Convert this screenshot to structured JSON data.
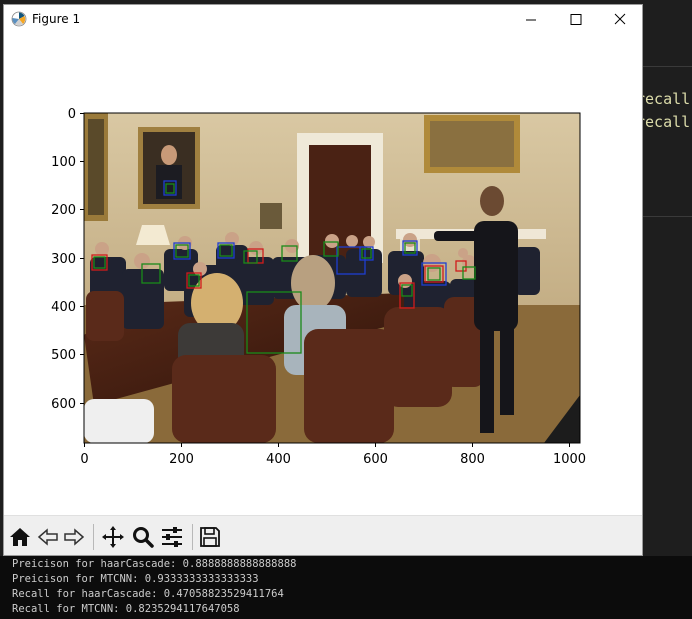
{
  "window": {
    "title": "Figure 1",
    "icons": [
      "matplotlib-logo-icon",
      "minimize-icon",
      "maximize-icon",
      "close-icon"
    ]
  },
  "editor": {
    "code_lines": [
      "recall",
      "recall"
    ],
    "text_color": "#dcdcaa"
  },
  "figure": {
    "x_ticks": [
      "0",
      "200",
      "400",
      "600",
      "800",
      "1000"
    ],
    "y_ticks": [
      "0",
      "100",
      "200",
      "300",
      "400",
      "500",
      "600"
    ],
    "image_width": 1024,
    "image_height": 683,
    "box_colors": {
      "blue": "#1f3fd0",
      "green": "#1a8a1a",
      "red": "#d01c1c"
    }
  },
  "toolbar": {
    "buttons": [
      "home-icon",
      "back-icon",
      "forward-icon",
      "pan-icon",
      "zoom-icon",
      "configure-subplots-icon",
      "save-icon"
    ]
  },
  "console": {
    "lines": [
      "Preicison for haarCascade: 0.8888888888888888",
      "Preicison for MTCNN: 0.9333333333333333",
      "Recall for haarCascade: 0.47058823529411764",
      "Recall for MTCNN: 0.8235294117647058"
    ]
  }
}
